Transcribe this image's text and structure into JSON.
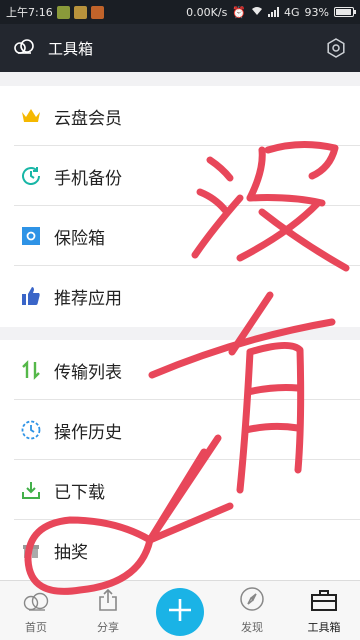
{
  "status_bar": {
    "time": "上午7:16",
    "network_speed": "0.00K/s",
    "network_type": "4G",
    "battery": "93%",
    "battery_level": 0.93
  },
  "header": {
    "title": "工具箱",
    "logo_icon": "cloud-icon",
    "settings_icon": "gear-icon"
  },
  "menu_groups": [
    {
      "items": [
        {
          "label": "云盘会员",
          "icon": "crown-icon",
          "color": "#f5b800"
        },
        {
          "label": "手机备份",
          "icon": "clock-backup-icon",
          "color": "#18b6a6"
        },
        {
          "label": "保险箱",
          "icon": "safe-icon",
          "color": "#2e93e6"
        },
        {
          "label": "推荐应用",
          "icon": "thumbs-up-icon",
          "color": "#3a65c8"
        }
      ]
    },
    {
      "items": [
        {
          "label": "传输列表",
          "icon": "transfer-icon",
          "color": "#55b849"
        },
        {
          "label": "操作历史",
          "icon": "history-icon",
          "color": "#2e93e6"
        },
        {
          "label": "已下载",
          "icon": "download-icon",
          "color": "#43b04a"
        },
        {
          "label": "抽奖",
          "icon": "lottery-icon",
          "color": "#888888"
        }
      ]
    }
  ],
  "tab_bar": {
    "tabs": [
      {
        "label": "首页",
        "icon": "cloud-home-icon"
      },
      {
        "label": "分享",
        "icon": "share-icon"
      },
      {
        "label": "",
        "icon": "plus-icon"
      },
      {
        "label": "发现",
        "icon": "compass-icon"
      },
      {
        "label": "工具箱",
        "icon": "toolbox-icon",
        "active": true
      }
    ],
    "fab_color": "#1ab3e6"
  },
  "overlay": {
    "handwriting": "没有",
    "ink_color": "#e8475a"
  }
}
